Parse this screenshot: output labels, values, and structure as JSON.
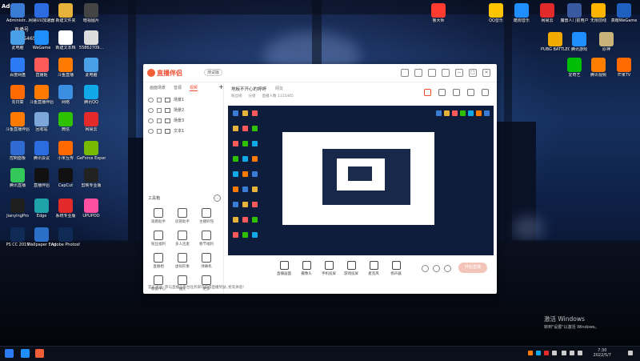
{
  "desktop": {
    "overlay": {
      "user": "Admi",
      "tag": "直播号",
      "number": "1115465"
    },
    "left_icons": [
      {
        "label": "Administr...",
        "color": "#3a7bd5"
      },
      {
        "label": "网易UU加速器",
        "color": "#2b6de0"
      },
      {
        "label": "新建文件夹",
        "color": "#e6b23a"
      },
      {
        "label": "暗视图片",
        "color": "#444444"
      },
      {
        "label": "此电脑",
        "color": "#4aa0e6"
      },
      {
        "label": "WeGame",
        "color": "#1f8fff"
      },
      {
        "label": "新建文本档",
        "color": "#ffffff"
      },
      {
        "label": "55862709...",
        "color": "#dddddd"
      },
      {
        "label": "百度网盘",
        "color": "#2d7bf4"
      },
      {
        "label": "直播姬",
        "color": "#ff5a5a"
      },
      {
        "label": "斗鱼直播",
        "color": "#ff7a00"
      },
      {
        "label": "此电脑",
        "color": "#4aa0e6"
      },
      {
        "label": "向日葵",
        "color": "#ff6a00"
      },
      {
        "label": "斗鱼直播伴侣",
        "color": "#ff7a00"
      },
      {
        "label": "网络",
        "color": "#3b8ee0"
      },
      {
        "label": "腾讯QQ",
        "color": "#11a8e8"
      },
      {
        "label": "斗鱼直播伴侣",
        "color": "#ff7a00"
      },
      {
        "label": "回收站",
        "color": "#7da7d9"
      },
      {
        "label": "微信",
        "color": "#2dc100"
      },
      {
        "label": "网易云",
        "color": "#e22a2a"
      },
      {
        "label": "控制面板",
        "color": "#2f6bd1"
      },
      {
        "label": "腾讯会议",
        "color": "#2b6de0"
      },
      {
        "label": "小米互传",
        "color": "#ff6900"
      },
      {
        "label": "GeForce Experience",
        "color": "#76b900"
      },
      {
        "label": "腾讯直播",
        "color": "#34c759"
      },
      {
        "label": "直播伴侣",
        "color": "#111111"
      },
      {
        "label": "CapCut",
        "color": "#111111"
      },
      {
        "label": "剪映专业版",
        "color": "#222222"
      },
      {
        "label": "JianyingPro",
        "color": "#1e1e1e"
      },
      {
        "label": "Edge",
        "color": "#1fa3a8"
      },
      {
        "label": "系统专业版",
        "color": "#e22a2a"
      },
      {
        "label": "UPUPOO",
        "color": "#ff4fa0"
      },
      {
        "label": "PS CC 2019",
        "color": "#0e2a55"
      },
      {
        "label": "Wallpaper Engine",
        "color": "#2a70c9"
      },
      {
        "label": "Adobe Photosh...",
        "color": "#0e2a55"
      }
    ],
    "right_icons": [
      {
        "label": "鲁大师",
        "color": "#ff3b30"
      },
      {
        "label": "QQ音乐",
        "color": "#ffc400"
      },
      {
        "label": "酷狗音乐",
        "color": "#1f8fff"
      },
      {
        "label": "网易云",
        "color": "#e22a2a"
      },
      {
        "label": "魔兽人门前用户",
        "color": "#3a5aa0"
      },
      {
        "label": "无限前线",
        "color": "#ffb400"
      },
      {
        "label": "真眼WeGame",
        "color": "#1f5fbf"
      },
      {
        "label": "PUBG BATTLEGR...",
        "color": "#f2a900"
      },
      {
        "label": "腾讯游戏",
        "color": "#1f8fff"
      },
      {
        "label": "原神",
        "color": "#c9b37a"
      },
      {
        "label": "爱奇艺",
        "color": "#00be06"
      },
      {
        "label": "腾讯视频",
        "color": "#ff7d00"
      },
      {
        "label": "芒果TV",
        "color": "#ff6a00"
      }
    ],
    "watermark": {
      "line1": "激活 Windows",
      "line2": "转到\"设置\"以激活 Windows。"
    }
  },
  "app": {
    "logo": "直播伴侣",
    "version": "测试版",
    "scene_tabs": [
      "画面场景",
      "音源",
      "视频"
    ],
    "sources": [
      {
        "name": "场景1"
      },
      {
        "name": "场景2"
      },
      {
        "name": "场景3"
      },
      {
        "name": "文本1"
      }
    ],
    "tools_title": "工具箱",
    "tools": [
      {
        "label": "观看助手"
      },
      {
        "label": "房管助手"
      },
      {
        "label": "主播铃铛"
      },
      {
        "label": "粉丝福利"
      },
      {
        "label": "多人连麦"
      },
      {
        "label": "春节福利"
      },
      {
        "label": "直播相"
      },
      {
        "label": "虚拟形象"
      },
      {
        "label": "弹幕机"
      },
      {
        "label": "数据中心"
      },
      {
        "label": "抽奖"
      },
      {
        "label": "更多"
      }
    ],
    "notice": "官方活动: 参与直播与平台任务即可获得直播奖励, 抢先体验!",
    "room": {
      "title": "地板不开心的婷婷",
      "category": "网友",
      "meta": [
        "粉丝榜",
        "分组",
        "直播人数 1115465"
      ]
    },
    "bottom_bar": [
      {
        "label": "直播画面"
      },
      {
        "label": "摄像头"
      },
      {
        "label": "手机投屏"
      },
      {
        "label": "游戏投屏"
      },
      {
        "label": "麦克风"
      },
      {
        "label": "扬声器"
      }
    ],
    "start_button": "开始直播"
  },
  "taskbar": {
    "time": "7:30",
    "date": "2022/5/7"
  }
}
